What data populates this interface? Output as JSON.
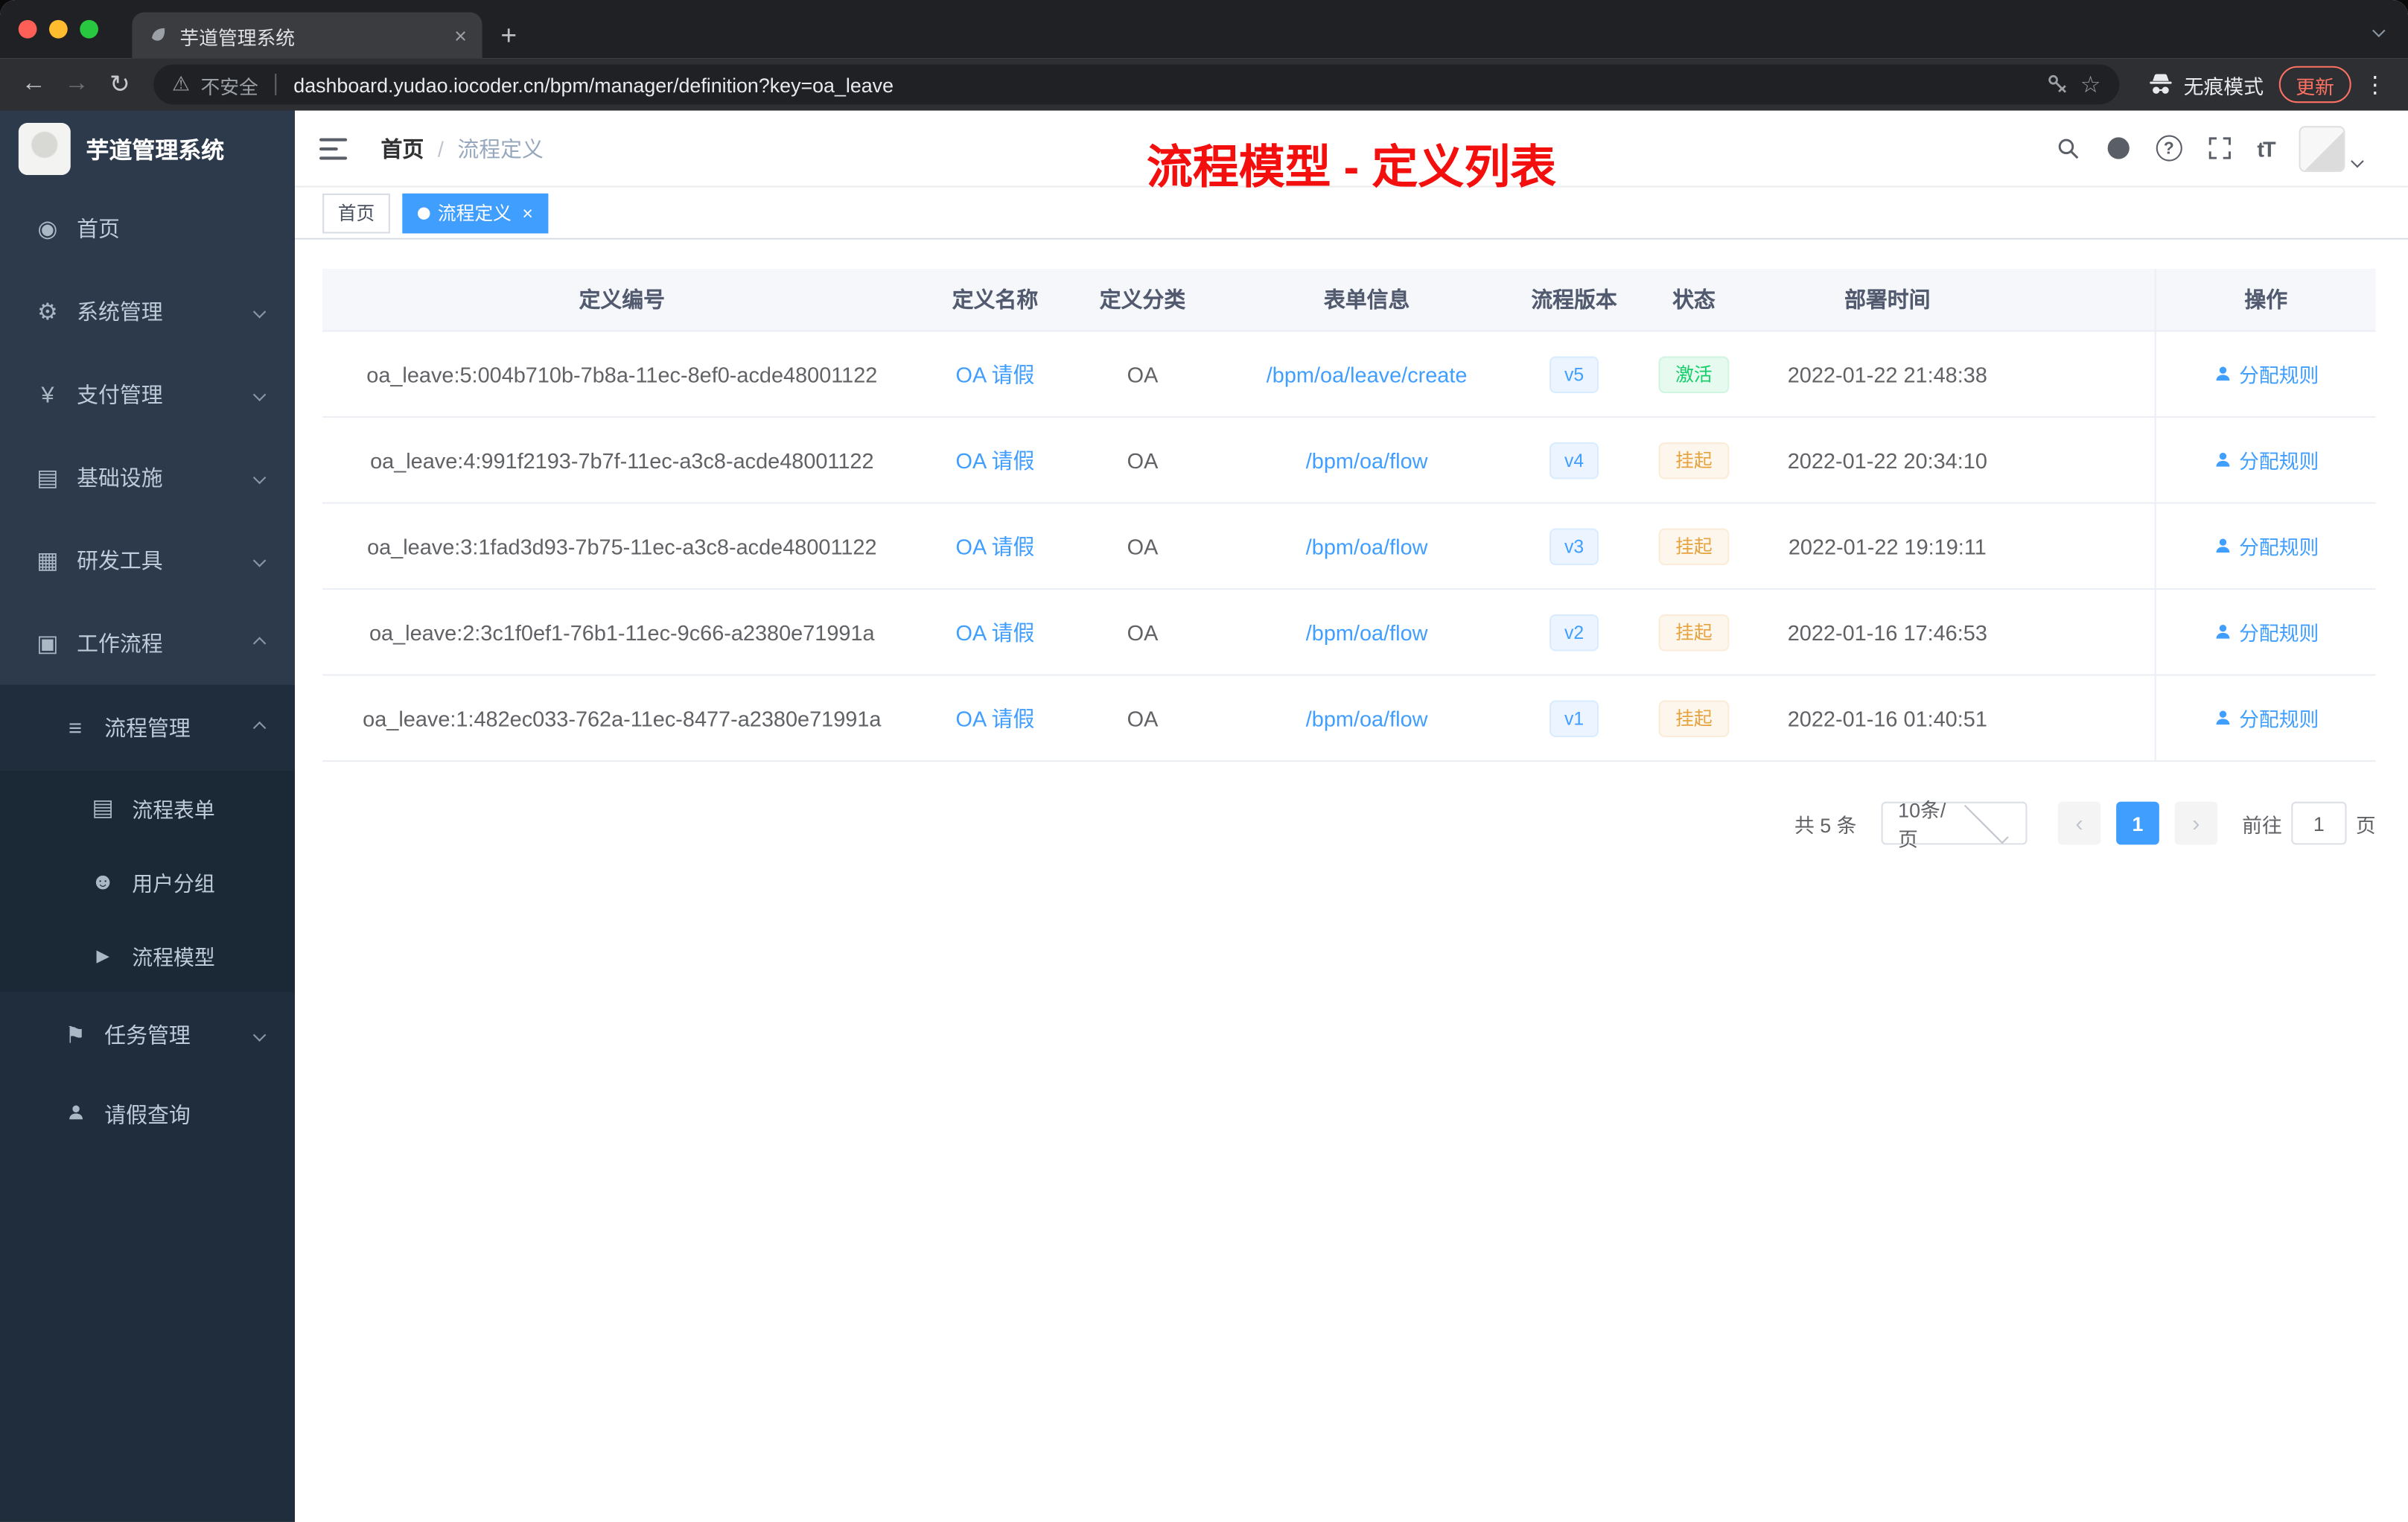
{
  "colors": {
    "primary": "#409eff",
    "success_text": "#13ce66",
    "warning_text": "#e6a23c",
    "annotation_red": "#f40f0f",
    "sidebar_bg": "#2d3a4b",
    "submenu_bg": "#1f2d3d"
  },
  "browser": {
    "tab_title": "芋道管理系统",
    "security_label": "不安全",
    "url": "dashboard.yudao.iocoder.cn/bpm/manager/definition?key=oa_leave",
    "incognito_label": "无痕模式",
    "update_label": "更新"
  },
  "sidebar": {
    "logo_title": "芋道管理系统",
    "items": [
      {
        "label": "首页",
        "icon": "dashboard-icon",
        "glyph": "◉"
      },
      {
        "label": "系统管理",
        "icon": "gear-icon",
        "glyph": "⚙",
        "chevron": "down"
      },
      {
        "label": "支付管理",
        "icon": "yen-icon",
        "glyph": "¥",
        "chevron": "down"
      },
      {
        "label": "基础设施",
        "icon": "infrastructure-icon",
        "glyph": "▤",
        "chevron": "down"
      },
      {
        "label": "研发工具",
        "icon": "dev-tools-icon",
        "glyph": "▦",
        "chevron": "down"
      },
      {
        "label": "工作流程",
        "icon": "workflow-icon",
        "glyph": "▣",
        "chevron": "up"
      },
      {
        "label": "流程管理",
        "icon": "process-list-icon",
        "glyph": "≡",
        "chevron": "up"
      },
      {
        "label": "流程表单",
        "icon": "form-icon",
        "glyph": "▤"
      },
      {
        "label": "用户分组",
        "icon": "user-group-icon",
        "glyph": "☻"
      },
      {
        "label": "流程模型",
        "icon": "model-icon",
        "glyph": "▶"
      },
      {
        "label": "任务管理",
        "icon": "task-icon",
        "glyph": "⚑",
        "chevron": "down"
      },
      {
        "label": "请假查询",
        "icon": "person-icon",
        "glyph": "☻"
      }
    ]
  },
  "header": {
    "breadcrumb_home": "首页",
    "breadcrumb_separator": "/",
    "breadcrumb_current": "流程定义",
    "annotation": "流程模型 - 定义列表"
  },
  "tags": {
    "home": "首页",
    "active": "流程定义"
  },
  "table": {
    "columns": [
      "定义编号",
      "定义名称",
      "定义分类",
      "表单信息",
      "流程版本",
      "状态",
      "部署时间",
      "操作"
    ],
    "rows": [
      {
        "id": "oa_leave:5:004b710b-7b8a-11ec-8ef0-acde48001122",
        "name": "OA 请假",
        "category": "OA",
        "form": "/bpm/oa/leave/create",
        "version": "v5",
        "status": "激活",
        "status_type": "success",
        "deploy_time": "2022-01-22 21:48:38",
        "action": "分配规则"
      },
      {
        "id": "oa_leave:4:991f2193-7b7f-11ec-a3c8-acde48001122",
        "name": "OA 请假",
        "category": "OA",
        "form": "/bpm/oa/flow",
        "version": "v4",
        "status": "挂起",
        "status_type": "warning",
        "deploy_time": "2022-01-22 20:34:10",
        "action": "分配规则"
      },
      {
        "id": "oa_leave:3:1fad3d93-7b75-11ec-a3c8-acde48001122",
        "name": "OA 请假",
        "category": "OA",
        "form": "/bpm/oa/flow",
        "version": "v3",
        "status": "挂起",
        "status_type": "warning",
        "deploy_time": "2022-01-22 19:19:11",
        "action": "分配规则"
      },
      {
        "id": "oa_leave:2:3c1f0ef1-76b1-11ec-9c66-a2380e71991a",
        "name": "OA 请假",
        "category": "OA",
        "form": "/bpm/oa/flow",
        "version": "v2",
        "status": "挂起",
        "status_type": "warning",
        "deploy_time": "2022-01-16 17:46:53",
        "action": "分配规则"
      },
      {
        "id": "oa_leave:1:482ec033-762a-11ec-8477-a2380e71991a",
        "name": "OA 请假",
        "category": "OA",
        "form": "/bpm/oa/flow",
        "version": "v1",
        "status": "挂起",
        "status_type": "warning",
        "deploy_time": "2022-01-16 01:40:51",
        "action": "分配规则"
      }
    ]
  },
  "pagination": {
    "total_label": "共 5 条",
    "page_size": "10条/页",
    "prev": "‹",
    "current_page": "1",
    "next": "›",
    "goto_prefix": "前往",
    "goto_value": "1",
    "goto_suffix": "页"
  }
}
